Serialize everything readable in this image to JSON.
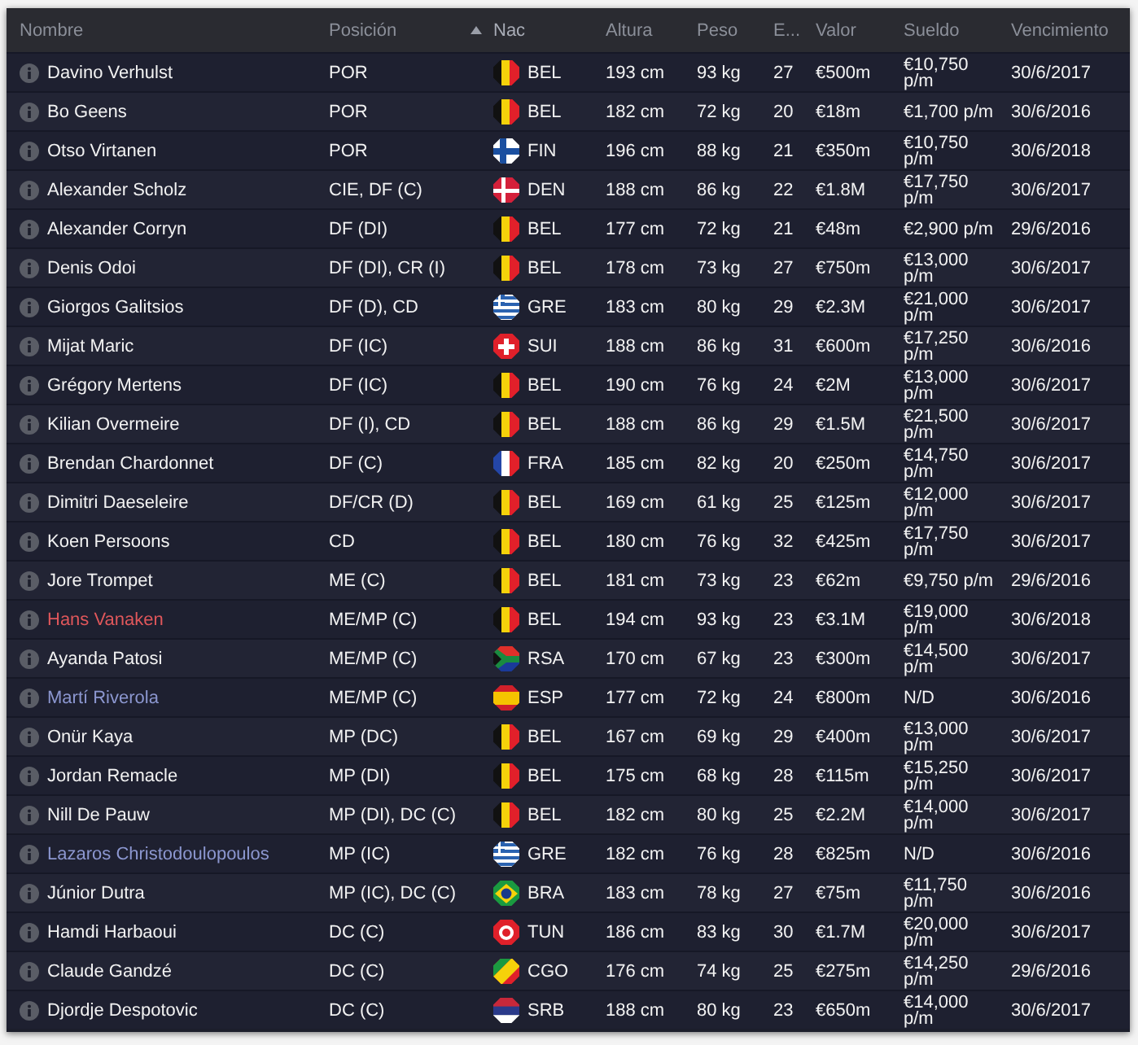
{
  "columns": [
    {
      "label": "Nombre",
      "sorted": false
    },
    {
      "label": "Posición",
      "sorted": false
    },
    {
      "label": "Nac",
      "sorted": true
    },
    {
      "label": "Altura",
      "sorted": false
    },
    {
      "label": "Peso",
      "sorted": false
    },
    {
      "label": "E...",
      "sorted": false
    },
    {
      "label": "Valor",
      "sorted": false
    },
    {
      "label": "Sueldo",
      "sorted": false
    },
    {
      "label": "Vencimiento",
      "sorted": false
    }
  ],
  "rows": [
    {
      "name": "Davino Verhulst",
      "color": "#f2f2f2",
      "position": "POR",
      "kind": "belgium",
      "nationality": "BEL",
      "height": "193 cm",
      "weight": "93 kg",
      "age": "27",
      "value": "€500m",
      "wage": "€10,750 p/m",
      "expires": "30/6/2017"
    },
    {
      "name": "Bo Geens",
      "color": "#f2f2f2",
      "position": "POR",
      "kind": "belgium",
      "nationality": "BEL",
      "height": "182 cm",
      "weight": "72 kg",
      "age": "20",
      "value": "€18m",
      "wage": "€1,700 p/m",
      "expires": "30/6/2016"
    },
    {
      "name": "Otso Virtanen",
      "color": "#f2f2f2",
      "position": "POR",
      "kind": "finland",
      "nationality": "FIN",
      "height": "196 cm",
      "weight": "88 kg",
      "age": "21",
      "value": "€350m",
      "wage": "€10,750 p/m",
      "expires": "30/6/2018"
    },
    {
      "name": "Alexander Scholz",
      "color": "#f2f2f2",
      "position": "CIE, DF (C)",
      "kind": "denmark",
      "nationality": "DEN",
      "height": "188 cm",
      "weight": "86 kg",
      "age": "22",
      "value": "€1.8M",
      "wage": "€17,750 p/m",
      "expires": "30/6/2017"
    },
    {
      "name": "Alexander Corryn",
      "color": "#f2f2f2",
      "position": "DF (DI)",
      "kind": "belgium",
      "nationality": "BEL",
      "height": "177 cm",
      "weight": "72 kg",
      "age": "21",
      "value": "€48m",
      "wage": "€2,900 p/m",
      "expires": "29/6/2016"
    },
    {
      "name": "Denis Odoi",
      "color": "#f2f2f2",
      "position": "DF (DI), CR (I)",
      "kind": "belgium",
      "nationality": "BEL",
      "height": "178 cm",
      "weight": "73 kg",
      "age": "27",
      "value": "€750m",
      "wage": "€13,000 p/m",
      "expires": "30/6/2017"
    },
    {
      "name": "Giorgos Galitsios",
      "color": "#f2f2f2",
      "position": "DF (D), CD",
      "kind": "greece",
      "nationality": "GRE",
      "height": "183 cm",
      "weight": "80 kg",
      "age": "29",
      "value": "€2.3M",
      "wage": "€21,000 p/m",
      "expires": "30/6/2017"
    },
    {
      "name": "Mijat Maric",
      "color": "#f2f2f2",
      "position": "DF (IC)",
      "kind": "switzerland",
      "nationality": "SUI",
      "height": "188 cm",
      "weight": "86 kg",
      "age": "31",
      "value": "€600m",
      "wage": "€17,250 p/m",
      "expires": "30/6/2016"
    },
    {
      "name": "Grégory Mertens",
      "color": "#f2f2f2",
      "position": "DF (IC)",
      "kind": "belgium",
      "nationality": "BEL",
      "height": "190 cm",
      "weight": "76 kg",
      "age": "24",
      "value": "€2M",
      "wage": "€13,000 p/m",
      "expires": "30/6/2017"
    },
    {
      "name": "Kilian Overmeire",
      "color": "#f2f2f2",
      "position": "DF (I), CD",
      "kind": "belgium",
      "nationality": "BEL",
      "height": "188 cm",
      "weight": "86 kg",
      "age": "29",
      "value": "€1.5M",
      "wage": "€21,500 p/m",
      "expires": "30/6/2017"
    },
    {
      "name": "Brendan Chardonnet",
      "color": "#f2f2f2",
      "position": "DF (C)",
      "kind": "france",
      "nationality": "FRA",
      "height": "185 cm",
      "weight": "82 kg",
      "age": "20",
      "value": "€250m",
      "wage": "€14,750 p/m",
      "expires": "30/6/2017"
    },
    {
      "name": "Dimitri Daeseleire",
      "color": "#f2f2f2",
      "position": "DF/CR (D)",
      "kind": "belgium",
      "nationality": "BEL",
      "height": "169 cm",
      "weight": "61 kg",
      "age": "25",
      "value": "€125m",
      "wage": "€12,000 p/m",
      "expires": "30/6/2017"
    },
    {
      "name": "Koen Persoons",
      "color": "#f2f2f2",
      "position": "CD",
      "kind": "belgium",
      "nationality": "BEL",
      "height": "180 cm",
      "weight": "76 kg",
      "age": "32",
      "value": "€425m",
      "wage": "€17,750 p/m",
      "expires": "30/6/2017"
    },
    {
      "name": "Jore Trompet",
      "color": "#f2f2f2",
      "position": "ME (C)",
      "kind": "belgium",
      "nationality": "BEL",
      "height": "181 cm",
      "weight": "73 kg",
      "age": "23",
      "value": "€62m",
      "wage": "€9,750 p/m",
      "expires": "29/6/2016"
    },
    {
      "name": "Hans Vanaken",
      "color": "#e0575b",
      "position": "ME/MP (C)",
      "kind": "belgium",
      "nationality": "BEL",
      "height": "194 cm",
      "weight": "93 kg",
      "age": "23",
      "value": "€3.1M",
      "wage": "€19,000 p/m",
      "expires": "30/6/2018"
    },
    {
      "name": "Ayanda Patosi",
      "color": "#f2f2f2",
      "position": "ME/MP (C)",
      "kind": "southafrica",
      "nationality": "RSA",
      "height": "170 cm",
      "weight": "67 kg",
      "age": "23",
      "value": "€300m",
      "wage": "€14,500 p/m",
      "expires": "30/6/2017"
    },
    {
      "name": "Martí Riverola",
      "color": "#8c97d0",
      "position": "ME/MP (C)",
      "kind": "spain",
      "nationality": "ESP",
      "height": "177 cm",
      "weight": "72 kg",
      "age": "24",
      "value": "€800m",
      "wage": "N/D",
      "expires": "30/6/2016"
    },
    {
      "name": "Onür Kaya",
      "color": "#f2f2f2",
      "position": "MP (DC)",
      "kind": "belgium",
      "nationality": "BEL",
      "height": "167 cm",
      "weight": "69 kg",
      "age": "29",
      "value": "€400m",
      "wage": "€13,000 p/m",
      "expires": "30/6/2017"
    },
    {
      "name": "Jordan Remacle",
      "color": "#f2f2f2",
      "position": "MP (DI)",
      "kind": "belgium",
      "nationality": "BEL",
      "height": "175 cm",
      "weight": "68 kg",
      "age": "28",
      "value": "€115m",
      "wage": "€15,250 p/m",
      "expires": "30/6/2017"
    },
    {
      "name": "Nill De Pauw",
      "color": "#f2f2f2",
      "position": "MP (DI), DC (C)",
      "kind": "belgium",
      "nationality": "BEL",
      "height": "182 cm",
      "weight": "80 kg",
      "age": "25",
      "value": "€2.2M",
      "wage": "€14,000 p/m",
      "expires": "30/6/2017"
    },
    {
      "name": "Lazaros Christodoulopoulos",
      "color": "#8c97d0",
      "position": "MP (IC)",
      "kind": "greece",
      "nationality": "GRE",
      "height": "182 cm",
      "weight": "76 kg",
      "age": "28",
      "value": "€825m",
      "wage": "N/D",
      "expires": "30/6/2016"
    },
    {
      "name": "Júnior Dutra",
      "color": "#f2f2f2",
      "position": "MP (IC), DC (C)",
      "kind": "brazil",
      "nationality": "BRA",
      "height": "183 cm",
      "weight": "78 kg",
      "age": "27",
      "value": "€75m",
      "wage": "€11,750 p/m",
      "expires": "30/6/2016"
    },
    {
      "name": "Hamdi Harbaoui",
      "color": "#f2f2f2",
      "position": "DC (C)",
      "kind": "tunisia",
      "nationality": "TUN",
      "height": "186 cm",
      "weight": "83 kg",
      "age": "30",
      "value": "€1.7M",
      "wage": "€20,000 p/m",
      "expires": "30/6/2017"
    },
    {
      "name": "Claude Gandzé",
      "color": "#f2f2f2",
      "position": "DC (C)",
      "kind": "congo",
      "nationality": "CGO",
      "height": "176 cm",
      "weight": "74 kg",
      "age": "25",
      "value": "€275m",
      "wage": "€14,250 p/m",
      "expires": "29/6/2016"
    },
    {
      "name": "Djordje Despotovic",
      "color": "#f2f2f2",
      "position": "DC (C)",
      "kind": "serbia",
      "nationality": "SRB",
      "height": "188 cm",
      "weight": "80 kg",
      "age": "23",
      "value": "€650m",
      "wage": "€14,000 p/m",
      "expires": "30/6/2017"
    }
  ]
}
